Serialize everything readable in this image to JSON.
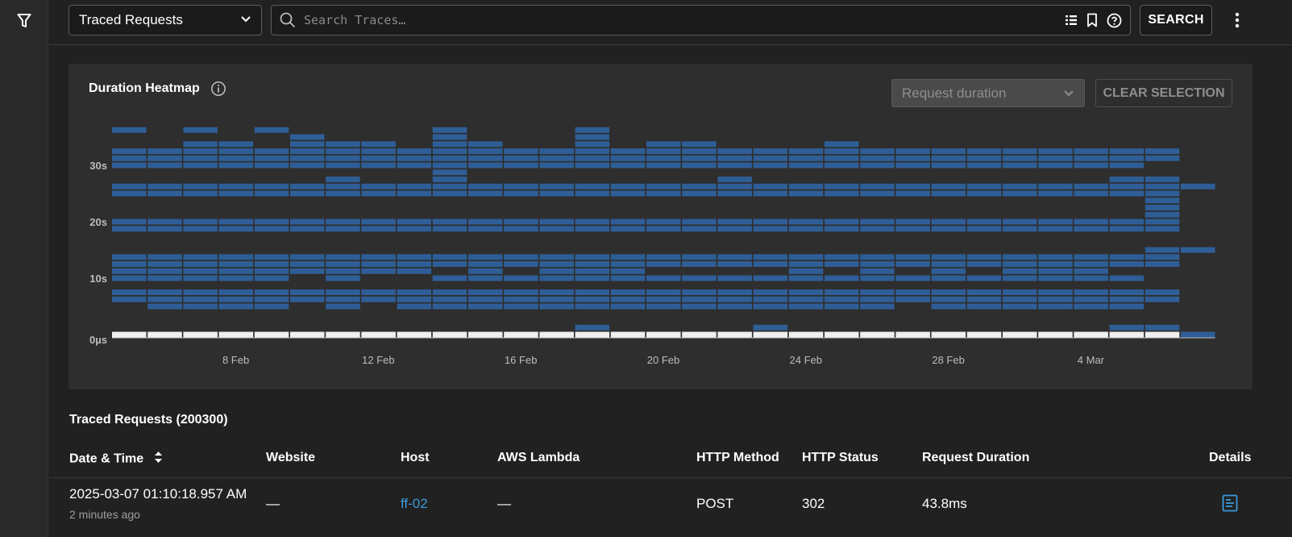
{
  "topbar": {
    "view_select_label": "Traced Requests",
    "search_placeholder": "Search Traces…",
    "search_button": "SEARCH"
  },
  "heatmap": {
    "title": "Duration Heatmap",
    "metric_select_label": "Request duration",
    "clear_button": "CLEAR SELECTION"
  },
  "chart_data": {
    "type": "heatmap",
    "title": "Duration Heatmap",
    "x_tick_labels": [
      "8 Feb",
      "12 Feb",
      "16 Feb",
      "20 Feb",
      "24 Feb",
      "28 Feb",
      "4 Mar"
    ],
    "y_tick_labels": [
      "0µs",
      "10s",
      "20s",
      "30s"
    ],
    "x_unit": "day",
    "y_unit": "seconds",
    "color_high": "#f0f0f0",
    "color_low": "#2f5e97",
    "days": [
      "2025-02-05",
      "2025-02-06",
      "2025-02-07",
      "2025-02-08",
      "2025-02-09",
      "2025-02-10",
      "2025-02-11",
      "2025-02-12",
      "2025-02-13",
      "2025-02-14",
      "2025-02-15",
      "2025-02-16",
      "2025-02-17",
      "2025-02-18",
      "2025-02-19",
      "2025-02-20",
      "2025-02-21",
      "2025-02-22",
      "2025-02-23",
      "2025-02-24",
      "2025-02-25",
      "2025-02-26",
      "2025-02-27",
      "2025-02-28",
      "2025-03-01",
      "2025-03-02",
      "2025-03-03",
      "2025-03-04",
      "2025-03-05",
      "2025-03-06",
      "2025-03-07"
    ],
    "duration_buckets_s": [
      0,
      1.25,
      2.5,
      3.75,
      5,
      6.25,
      7.5,
      8.75,
      10,
      11.25,
      12.5,
      13.75,
      15,
      16.25,
      17.5,
      18.75,
      20,
      21.25,
      22.5,
      23.75,
      25,
      26.25,
      27.5,
      28.75,
      30,
      31.25,
      32.5,
      33.75,
      35,
      36.25
    ],
    "dense_high": [
      0
    ],
    "dense_low": [
      5,
      6,
      10,
      11,
      15,
      16,
      20,
      21,
      25,
      26
    ],
    "extra_cells": [
      {
        "day": 0,
        "buckets": [
          29,
          24,
          8,
          9
        ]
      },
      {
        "day": 1,
        "buckets": [
          24,
          8,
          9,
          4
        ]
      },
      {
        "day": 2,
        "buckets": [
          29,
          27,
          24,
          8,
          9,
          4,
          5
        ]
      },
      {
        "day": 3,
        "buckets": [
          27,
          24,
          8,
          9,
          4
        ]
      },
      {
        "day": 4,
        "buckets": [
          29,
          24,
          8,
          9,
          4,
          5
        ]
      },
      {
        "day": 5,
        "buckets": [
          27,
          24,
          28,
          9
        ]
      },
      {
        "day": 6,
        "buckets": [
          27,
          24,
          22,
          8,
          9,
          4
        ]
      },
      {
        "day": 7,
        "buckets": [
          27,
          24,
          9
        ]
      },
      {
        "day": 8,
        "buckets": [
          24,
          9,
          4,
          5
        ]
      },
      {
        "day": 9,
        "buckets": [
          29,
          28,
          27,
          24,
          23,
          22,
          8,
          4
        ]
      },
      {
        "day": 10,
        "buckets": [
          27,
          26,
          24,
          8,
          9,
          4,
          5
        ]
      },
      {
        "day": 11,
        "buckets": [
          24,
          8,
          4
        ]
      },
      {
        "day": 12,
        "buckets": [
          26,
          24,
          8,
          9,
          4
        ]
      },
      {
        "day": 13,
        "buckets": [
          29,
          28,
          27,
          24,
          25,
          8,
          9,
          4,
          1
        ]
      },
      {
        "day": 14,
        "buckets": [
          26,
          24,
          25,
          8,
          9,
          4
        ]
      },
      {
        "day": 15,
        "buckets": [
          27,
          26,
          24,
          8,
          4,
          5
        ]
      },
      {
        "day": 16,
        "buckets": [
          27,
          26,
          24,
          8,
          4,
          5
        ]
      },
      {
        "day": 17,
        "buckets": [
          26,
          24,
          22,
          8,
          4
        ]
      },
      {
        "day": 18,
        "buckets": [
          24,
          8,
          4,
          5,
          1
        ]
      },
      {
        "day": 19,
        "buckets": [
          24,
          8,
          9,
          4,
          5
        ]
      },
      {
        "day": 20,
        "buckets": [
          27,
          24,
          8,
          4,
          5
        ]
      },
      {
        "day": 21,
        "buckets": [
          24,
          8,
          9,
          4,
          5
        ]
      },
      {
        "day": 22,
        "buckets": [
          24,
          8,
          5
        ]
      },
      {
        "day": 23,
        "buckets": [
          24,
          8,
          9,
          4
        ]
      },
      {
        "day": 24,
        "buckets": [
          24,
          8,
          4
        ]
      },
      {
        "day": 25,
        "buckets": [
          26,
          24,
          8,
          9,
          4,
          5
        ]
      },
      {
        "day": 26,
        "buckets": [
          24,
          8,
          9,
          4,
          5
        ]
      },
      {
        "day": 27,
        "buckets": [
          24,
          8,
          9,
          4,
          5
        ]
      },
      {
        "day": 28,
        "buckets": [
          26,
          24,
          22,
          8,
          4,
          1
        ]
      },
      {
        "day": 29,
        "buckets": [
          19,
          18,
          17,
          12,
          1,
          22
        ]
      },
      {
        "day": 30,
        "buckets": []
      }
    ],
    "y_range_s": [
      0,
      36
    ],
    "grid": false,
    "legend": "none"
  },
  "table": {
    "title": "Traced Requests (200300)",
    "columns": [
      "Date & Time",
      "Website",
      "Host",
      "AWS Lambda",
      "HTTP Method",
      "HTTP Status",
      "Request Duration",
      "Details"
    ],
    "rows": [
      {
        "datetime": "2025-03-07 01:10:18.957 AM",
        "relative": "2 minutes ago",
        "website": "—",
        "host": "ff-02",
        "lambda": "—",
        "method": "POST",
        "status": "302",
        "duration": "43.8ms"
      }
    ]
  }
}
